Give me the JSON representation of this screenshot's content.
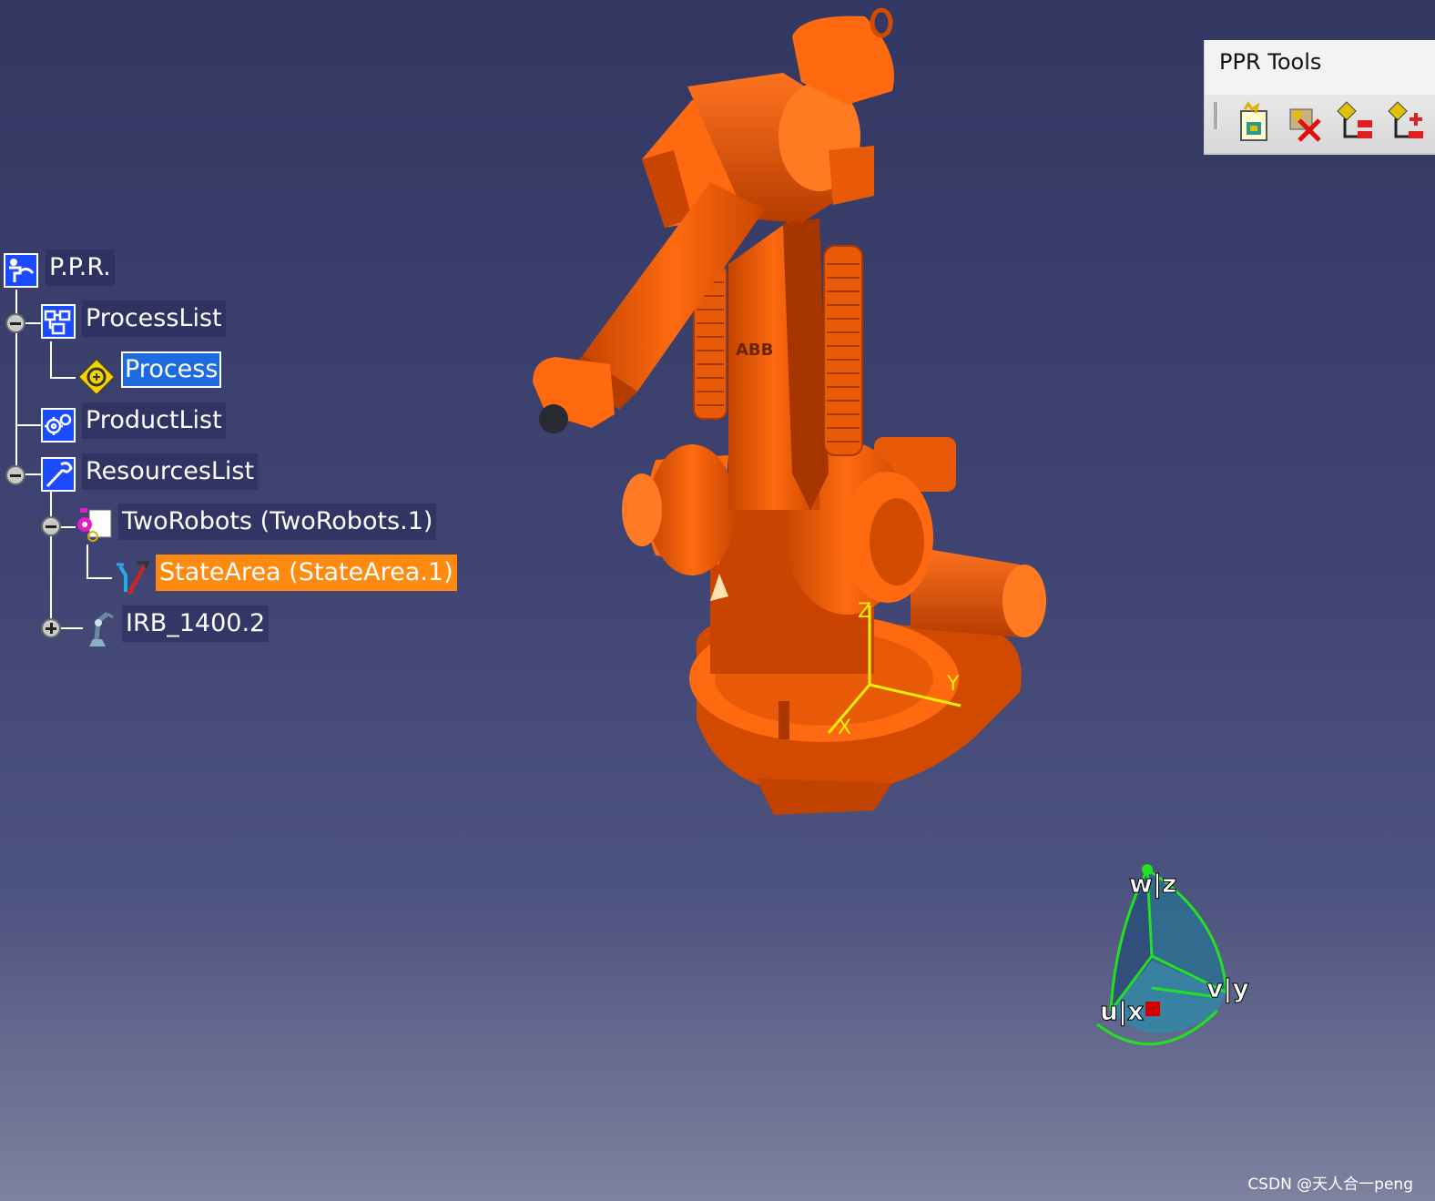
{
  "tree": {
    "root": {
      "label": "P.P.R.",
      "icon": "ppr-root-icon"
    },
    "process_list": {
      "label": "ProcessList",
      "icon": "process-list-icon"
    },
    "process": {
      "label": "Process",
      "icon": "process-icon",
      "selected": true
    },
    "product_list": {
      "label": "ProductList",
      "icon": "product-list-icon"
    },
    "resources_list": {
      "label": "ResourcesList",
      "icon": "resources-list-icon"
    },
    "two_robots": {
      "label": "TwoRobots (TwoRobots.1)",
      "icon": "robot-cell-icon"
    },
    "state_area": {
      "label": "StateArea (StateArea.1)",
      "icon": "state-area-icon",
      "highlighted": true
    },
    "irb": {
      "label": "IRB_1400.2",
      "icon": "robot-icon"
    }
  },
  "toolbar": {
    "title": "PPR Tools",
    "buttons": [
      {
        "name": "new-ppr-button",
        "icon": "new-document-icon"
      },
      {
        "name": "delete-ppr-button",
        "icon": "delete-icon"
      },
      {
        "name": "reorder-ppr-button",
        "icon": "reorder-icon"
      },
      {
        "name": "add-ppr-button",
        "icon": "add-icon"
      }
    ]
  },
  "model": {
    "logo_text": "ABB",
    "axis_labels": {
      "x": "X",
      "y": "Y",
      "z": "Z"
    }
  },
  "compass": {
    "labels": {
      "w": "w|z",
      "v": "v|y",
      "u": "u|x"
    }
  },
  "watermark": "CSDN @天人合一peng",
  "colors": {
    "robot": "#ee5a05",
    "robot_dark": "#b63c00",
    "selection_blue": "#1e6be0",
    "highlight_orange": "#ff8a10",
    "axis_yellow": "#f2f200",
    "compass_green": "#22e022"
  }
}
